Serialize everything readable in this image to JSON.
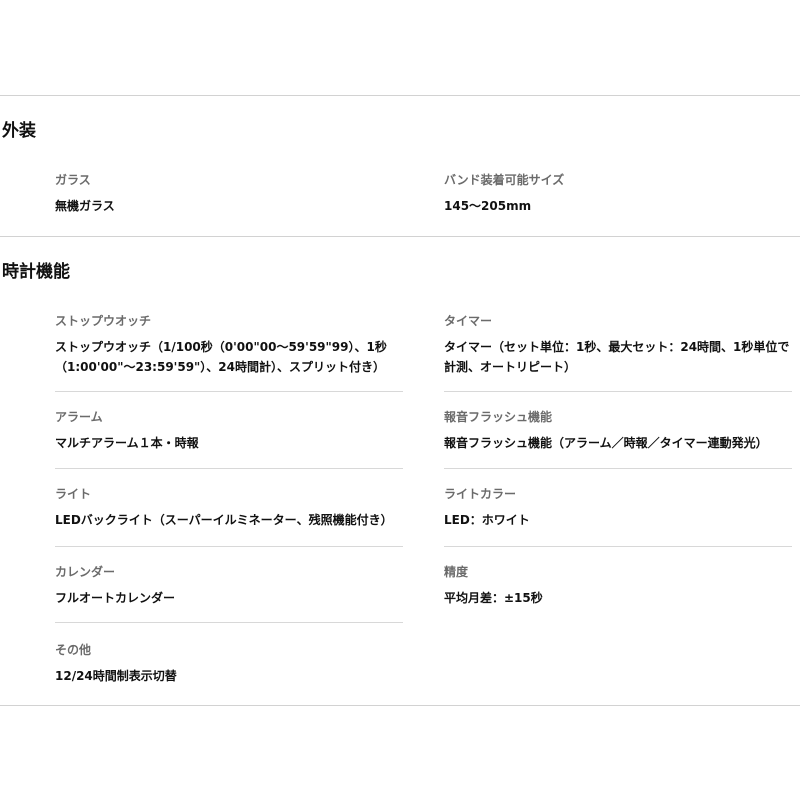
{
  "sections": [
    {
      "title": "外装",
      "rows": [
        [
          {
            "label": "ガラス",
            "value": "無機ガラス"
          },
          {
            "label": "バンド装着可能サイズ",
            "value": "145〜205mm"
          }
        ]
      ]
    },
    {
      "title": "時計機能",
      "rows": [
        [
          {
            "label": "ストップウオッチ",
            "value_lines": [
              "ストップウオッチ（1/100秒（0'00\"00〜59'59\"99）、1秒",
              "（1:00'00\"〜23:59'59\"）、24時間計）、スプリット付き）"
            ]
          },
          {
            "label": "タイマー",
            "value_lines": [
              "タイマー（セット単位：1秒、最大セット：24時間、1秒単位で",
              "計測、オートリピート）"
            ]
          }
        ],
        [
          {
            "label": "アラーム",
            "value": "マルチアラーム１本・時報"
          },
          {
            "label": "報音フラッシュ機能",
            "value": "報音フラッシュ機能（アラーム／時報／タイマー連動発光）"
          }
        ],
        [
          {
            "label": "ライト",
            "value": "LEDバックライト（スーパーイルミネーター、残照機能付き）"
          },
          {
            "label": "ライトカラー",
            "value": "LED：ホワイト"
          }
        ],
        [
          {
            "label": "カレンダー",
            "value": "フルオートカレンダー"
          },
          {
            "label": "精度",
            "value": "平均月差：±15秒"
          }
        ],
        [
          {
            "label": "その他",
            "value": "12/24時間制表示切替"
          }
        ]
      ]
    }
  ]
}
